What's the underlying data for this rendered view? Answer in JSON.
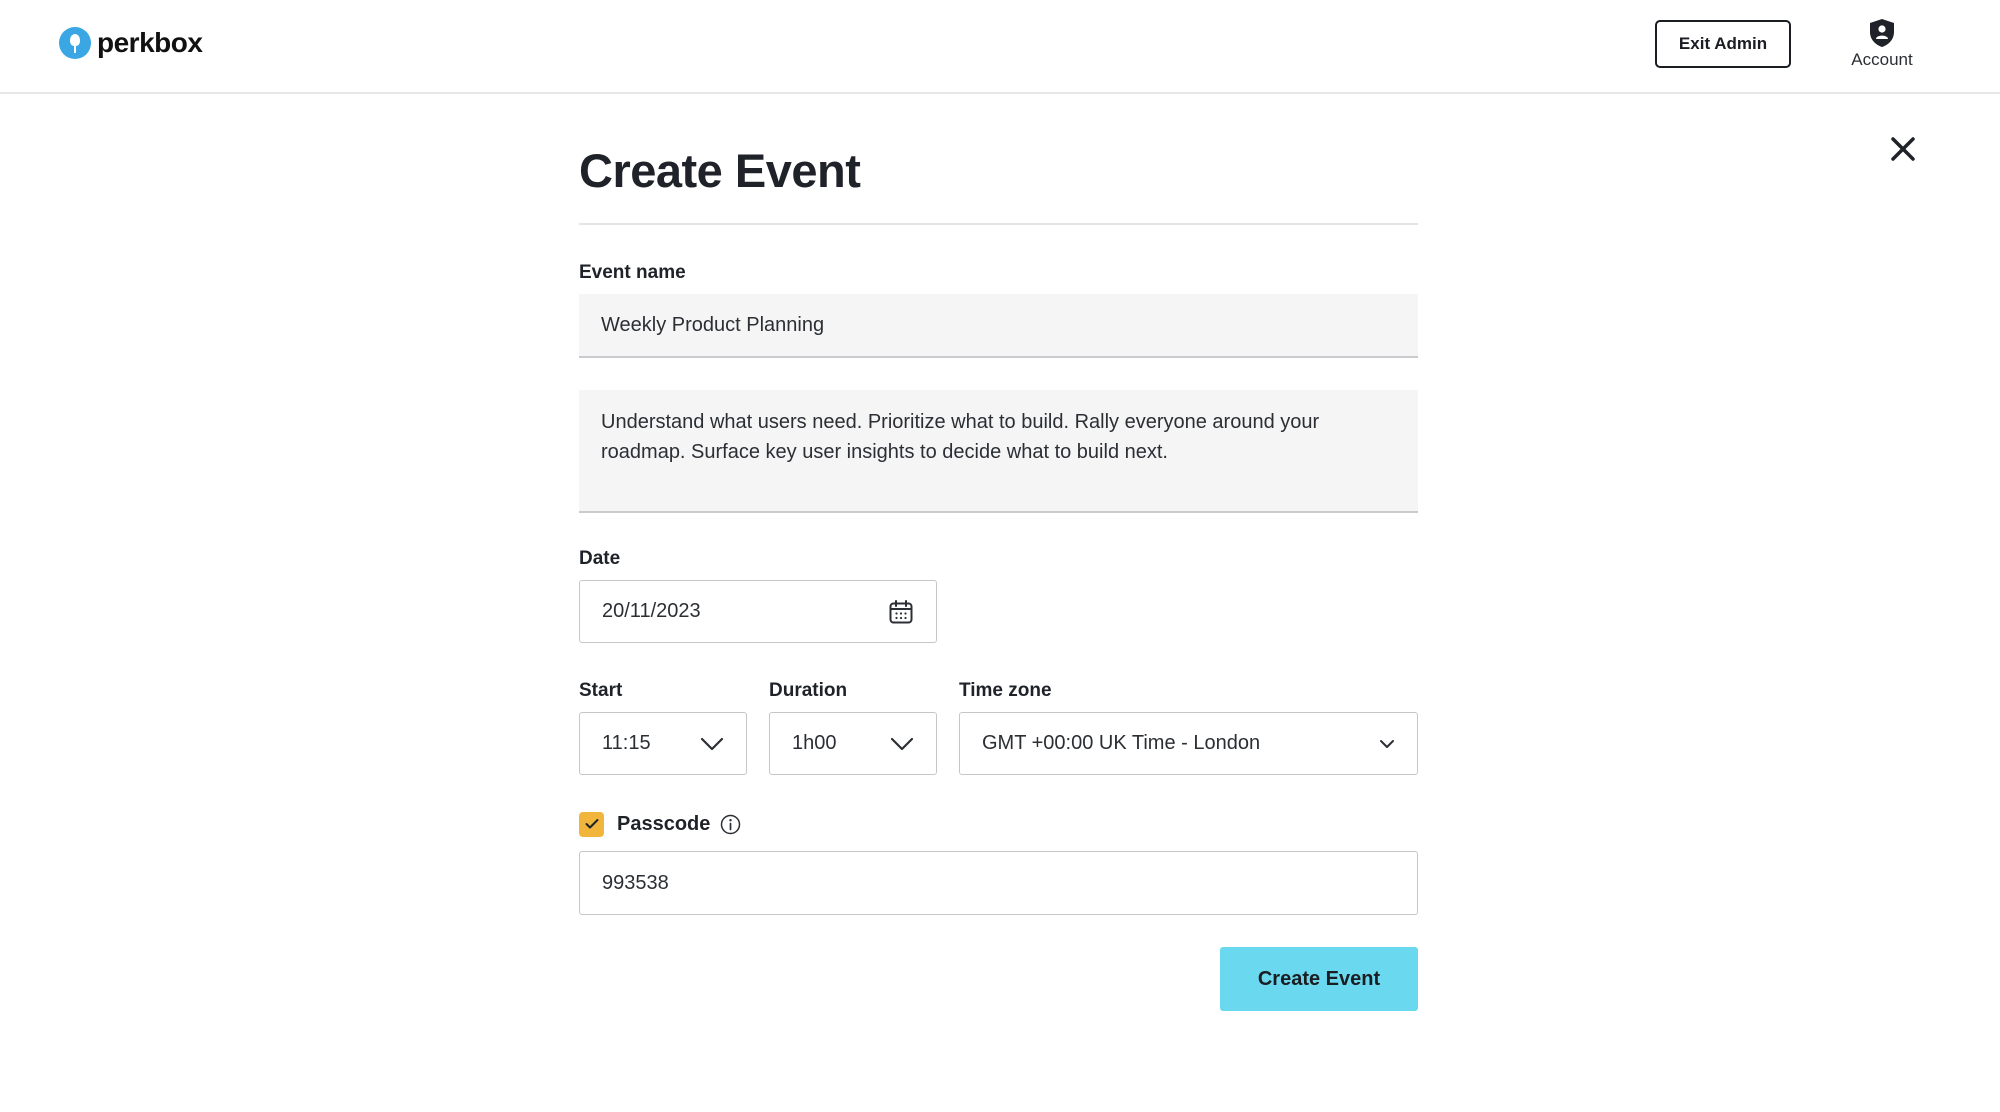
{
  "header": {
    "logo_text": "perkbox",
    "exit_admin_label": "Exit Admin",
    "account_label": "Account"
  },
  "form": {
    "title": "Create Event",
    "event_name_label": "Event name",
    "event_name_value": "Weekly Product Planning",
    "description_value": "Understand what users need. Prioritize what to build. Rally everyone around your roadmap. Surface key user insights to decide what to build next.",
    "date_label": "Date",
    "date_value": "20/11/2023",
    "start_label": "Start",
    "start_value": "11:15",
    "duration_label": "Duration",
    "duration_value": "1h00",
    "timezone_label": "Time zone",
    "timezone_value": "GMT +00:00 UK Time - London",
    "passcode_label": "Passcode",
    "passcode_checked": true,
    "passcode_value": "993538",
    "submit_label": "Create Event"
  },
  "colors": {
    "brand_blue": "#3aa6e4",
    "checkbox_orange": "#f2b53c",
    "submit_cyan": "#6ad8ee"
  },
  "icons": [
    "perkbox-logo-icon",
    "account-shield-icon",
    "close-icon",
    "calendar-icon",
    "chevron-down-icon",
    "checkmark-icon",
    "info-icon"
  ]
}
